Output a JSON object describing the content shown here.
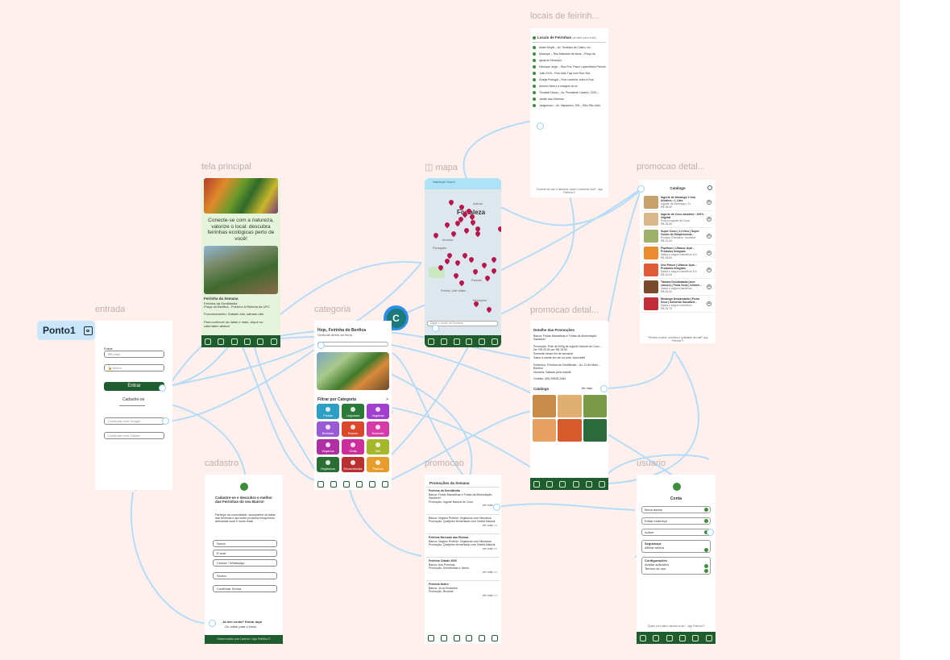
{
  "frames": {
    "entrada": "entrada",
    "tela_principal": "tela principal",
    "categoria": "categoria",
    "cadastro": "cadastro",
    "mapa": "mapa",
    "locais": "locais de feirinh...",
    "promocao_detal_top": "promocao detal...",
    "promocao_detal_mid": "promocao detal...",
    "promocao": "promocao",
    "usuario": "usuario"
  },
  "flow_start": {
    "label": "Ponto1"
  },
  "avatar": {
    "letter": "C"
  },
  "entrada": {
    "title": "Entrar",
    "email": "E-Mail",
    "senha": "Senha",
    "button": "Entrar",
    "cadastre": "Cadastre-se",
    "social_google": "Continuar com Google",
    "social_celular": "Continuar com Celular"
  },
  "principal": {
    "headline": "Conecte-se com a natureza, valorize o local: descubra feirinhas ecológicas perto de você!",
    "feirinha_title": "Feirinha da Semana",
    "feirinha_name": "Feirinha da Gentilândia",
    "feirinha_place": "Praça do Benfica - Próximo à Reitoria da UFC",
    "feirinha_hours": "Funcionamento: Sábado sim, sábado não",
    "feirinha_cta": "Para conhecer as datas e mais, clique no calendário abaixo!"
  },
  "categoria": {
    "header": "Hoje, Feirinha do Benfica",
    "subheader": "Verduras direto da horta",
    "filter_title": "Filtrar por Categoria",
    "filter_arrow": ">",
    "tiles": [
      {
        "label": "Frutas",
        "color": "#2e9fc4"
      },
      {
        "label": "Legumes",
        "color": "#2c7a3a"
      },
      {
        "label": "Vegetais",
        "color": "#a13ecf"
      },
      {
        "label": "Bebidas",
        "color": "#9a5ad4"
      },
      {
        "label": "Raízes",
        "color": "#d9482a"
      },
      {
        "label": "Naturais",
        "color": "#d63aa8"
      },
      {
        "label": "Veganos",
        "color": "#b02fa5"
      },
      {
        "label": "Chás",
        "color": "#cc2f9c"
      },
      {
        "label": "Mel",
        "color": "#a5b72a"
      },
      {
        "label": "Orgânicos",
        "color": "#2a6e34"
      },
      {
        "label": "Encomendas",
        "color": "#b93030"
      },
      {
        "label": "Plantas",
        "color": "#e89c2a"
      }
    ]
  },
  "cadastro": {
    "title": "Cadastre-se e descubra o melhor das Feirinhas do seu Bairro!",
    "intro": "Participe da comunidade, acompanhe as datas das feirinhas e aproveite produtos fresquinhos, artesanais local e muito mais!",
    "fields": [
      "Nome",
      "E-mail",
      "Celular / WhatsApp",
      "Senha",
      "Confirmar Senha"
    ],
    "login_prompt": "Já tem conta? Entrar aqui",
    "back": "Ou voltar para o início",
    "footer": "Desenvolvido com Carinho • App Feirinha ©"
  },
  "mapa": {
    "city": "Fortaleza",
    "places": [
      "Nautique Soure",
      "Hospital Pr...",
      "Aldeota",
      "Cocó",
      "Papicu",
      "Montese",
      "Parangaba",
      "Passaré",
      "Messejana",
      "Maraponga",
      "Prefeito José Walter",
      "Jardim das Oliveiras",
      "Shopping Iguatemi",
      "Parque Municipal Lagoa da Maraponga"
    ],
    "search_placeholder": "Digite o nome da Semana"
  },
  "locais": {
    "title": "Locais de Feirinhas",
    "subtitle": "(arraste para mais)",
    "items": [
      "Assim Moyle – Av. Teodósio de Castro, s/n",
      "Mucuripe – Rua Machado de Assis – Praça da",
      "Igreja do Mucuripe",
      "Henrique Jorge – Rua Prof. Paulo Lopes/Mário Peixoto",
      "João XXIII – Rua João Tupi com Rua Viva",
      "Granja Portugal – Rua Lourinha, entre a Rua",
      "Antônio Neto e a margem do rio",
      "Trindade Novos – Av. Presidente Castelo, 1294 –",
      "Jardim das Oliveiras",
      "Jangurussu – Av. Valparaíso, S/N – Sítio São João"
    ],
    "footer": "\"Conecte-se com a natureza, apoie o comércio local\" - App Feirinha ©"
  },
  "catalogo": {
    "title": "Catálogo",
    "items": [
      {
        "name": "Iogurte de Morango e Uva Alcalino • 1 Litro",
        "meta": "Iogurte de Morango • 1L",
        "price": "R$ 28,00",
        "color": "#c9a06a"
      },
      {
        "name": "Iogurte de Coco Alcalino • 100% Vegetal",
        "meta": "Possui iogurte de Coco",
        "price": "R$ 28,00",
        "color": "#d9b98a"
      },
      {
        "name": "Super Coco | 1,0 litro | Super Gordo de Dimplementa...",
        "meta": "Produto Exclusivo, Inovador",
        "price": "R$ 22,00",
        "color": "#9fb06a"
      },
      {
        "name": "Pepfiturc | Ultasuc Açaí – Produtos Integrais",
        "meta": "Saiba o seguro benefício 6,9",
        "price": "R$ 18,50",
        "color": "#ec8a30"
      },
      {
        "name": "Uno Pasco | Ultasuc Açaí – Produtos Integrais",
        "meta": "Saiba o seguro benefício 6,9",
        "price": "R$ 19,00",
        "color": "#e05a38"
      },
      {
        "name": "Tâmara Desidratada (sem caroço) | Fruta Seca | Alimen...",
        "meta": "Saiba o seguro benefício",
        "price": "R$ 26,00",
        "color": "#7a4a2a"
      },
      {
        "name": "Morango Desidratado | Fruta Seca | Alimento Saudável...",
        "meta": "Saiba o seguro benefício",
        "price": "R$ 24,70",
        "color": "#c22f3a"
      }
    ],
    "footer": "\"Feirinha a sabor, produtos e qualidade da vida!\" App Feirinha ©"
  },
  "detalhes": {
    "title": "Detalhe das Promoções",
    "line1": "Banca: Frutas Maravilhas e Frutas da Alimentação Saudável",
    "line2": "Promoção: Pote de 500g de Iogurte Natural de Coco – De: R$ 25,90 por R$ 15,90",
    "line3": "Somente nesse fim de semana!",
    "line4": "Sabor a saúde em um só pote. Aproveite!",
    "address": "Endereço: Feirinha da Gentilândia – Av. 13 de Maio – Benfica",
    "hours": "Horários: Sábado pela manhã",
    "contact": "Contato: (85) 99928-2483",
    "catalog_label": "Catálogo",
    "catalog_more": "Ver mais",
    "catalog_colors": [
      "#c98b4a",
      "#e0b070",
      "#7a9a4a",
      "#e8a060",
      "#d65a2a",
      "#2b6a3a"
    ]
  },
  "promocao": {
    "title": "Promoções da Semana",
    "sections": [
      {
        "feira": "Feirinha da Gentilândia",
        "banca": "Banca: Frutas Maravilhas e Frutas da Alimentação Saudável",
        "promo": "Promoção: Iogurte Natural de Coco",
        "more": "ver mais >>"
      },
      {
        "feira": "",
        "banca": "Banca: Vegano Perfeito: Orgânicos com Mendeza",
        "promo": "Promoção: Queijinho fermentado com Geleia Natural",
        "more": "ver mais >>"
      },
      {
        "feira": "Feirinha Mercado das Pimbas",
        "banca": "Banca: Vegano Perfeito: Orgânicos com Mendeza",
        "promo": "Promoção: Queijinho fermentado com Geleia Natural",
        "more": "ver mais >>"
      },
      {
        "feira": "Feirinha Cidade 2000",
        "banca": "Banca: Ana Pominas",
        "promo": "Promoção: Sorvetinhas e Jarros",
        "more": "ver mais >>"
      },
      {
        "feira": "Feirinha Nobre",
        "banca": "Banca: Jô do Brownies",
        "promo": "Promoção: Brownie",
        "more": "ver mais >>"
      }
    ]
  },
  "usuario": {
    "title": "Conta",
    "rows": [
      "Meus dados",
      "Editar endereço",
      "Avisar"
    ],
    "sec_title": "Segurança",
    "sec_rows": [
      "Alterar senha"
    ],
    "conf_title": "Configurações",
    "conf_rows": [
      "Avaliar aplicativo",
      "Termos de uso"
    ],
    "footer": "\"Quem a do bairro valoriza a raiz\" - App Feirinha ©"
  }
}
